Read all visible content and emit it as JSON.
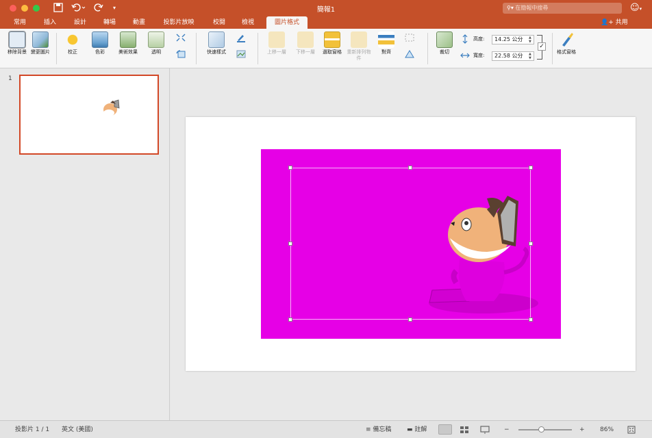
{
  "window": {
    "title": "簡報1",
    "search_placeholder": "在簡報中搜尋"
  },
  "tabs": [
    {
      "label": "常用"
    },
    {
      "label": "插入"
    },
    {
      "label": "設計"
    },
    {
      "label": "轉場"
    },
    {
      "label": "動畫"
    },
    {
      "label": "投影片放映"
    },
    {
      "label": "校閱"
    },
    {
      "label": "檢視"
    },
    {
      "label": "圖片格式",
      "active": true
    }
  ],
  "share_label": "共用",
  "ribbon": {
    "remove_background": "移除背景",
    "change_picture": "變更圖片",
    "corrections": "校正",
    "color": "色彩",
    "artistic_effects": "美術效果",
    "transparency": "透明",
    "quick_styles": "快速樣式",
    "bring_forward": "上移一層",
    "send_backward": "下移一層",
    "selection_pane": "選取窗格",
    "reorder_objects": "重新排列物件",
    "align": "對齊",
    "crop": "裁切",
    "height_label": "高度:",
    "height_value": "14.25 公分",
    "width_label": "寬度:",
    "width_value": "22.58 公分",
    "format_pane": "格式窗格"
  },
  "thumbnails": [
    {
      "number": "1"
    }
  ],
  "statusbar": {
    "slide_info": "投影片 1 / 1",
    "language": "英文 (美國)",
    "notes": "備忘稿",
    "comments": "註解",
    "zoom_minus": "−",
    "zoom_plus": "+",
    "zoom": "86%"
  },
  "colors": {
    "accent": "#c55029",
    "picture_bg": "#e600e6",
    "selection_border": "#d24726"
  },
  "icons": [
    "save-icon",
    "undo-icon",
    "redo-icon",
    "customize-icon",
    "search-icon",
    "smiley-icon",
    "add-person-icon",
    "fit-window-icon"
  ]
}
